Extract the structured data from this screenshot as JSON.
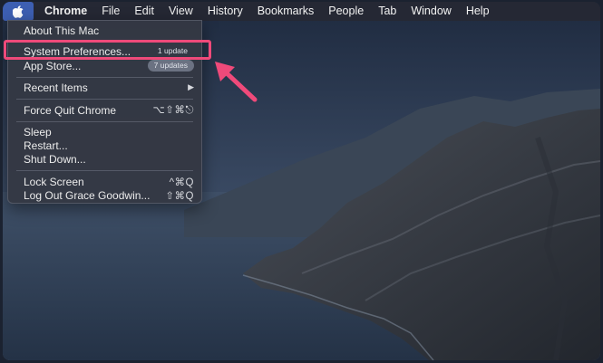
{
  "menubar": {
    "apple_icon": "apple-logo-icon",
    "items": [
      {
        "label": "Chrome"
      },
      {
        "label": "File"
      },
      {
        "label": "Edit"
      },
      {
        "label": "View"
      },
      {
        "label": "History"
      },
      {
        "label": "Bookmarks"
      },
      {
        "label": "People"
      },
      {
        "label": "Tab"
      },
      {
        "label": "Window"
      },
      {
        "label": "Help"
      }
    ]
  },
  "apple_menu": {
    "about": "About This Mac",
    "system_preferences": {
      "label": "System Preferences...",
      "badge": "1 update"
    },
    "app_store": {
      "label": "App Store...",
      "badge": "7 updates"
    },
    "recent_items": {
      "label": "Recent Items",
      "submenu_icon": "triangle-right-icon"
    },
    "force_quit": {
      "label": "Force Quit Chrome",
      "shortcut": "⌥⇧⌘⎋"
    },
    "sleep": "Sleep",
    "restart": "Restart...",
    "shut_down": "Shut Down...",
    "lock_screen": {
      "label": "Lock Screen",
      "shortcut": "^⌘Q"
    },
    "log_out": {
      "label": "Log Out Grace Goodwin...",
      "shortcut": "⇧⌘Q"
    }
  },
  "annotation": {
    "color": "#ef4a7a"
  }
}
